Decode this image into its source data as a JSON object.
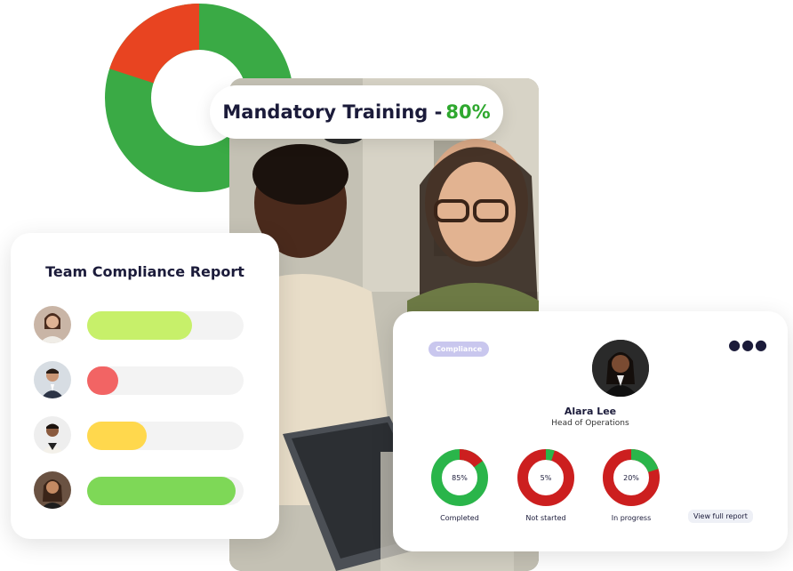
{
  "banner": {
    "label": "Mandatory Training -",
    "percent": "80%",
    "accent_color": "#2fa82f"
  },
  "big_donut": {
    "completed_fraction": 0.8,
    "remaining_fraction": 0.2,
    "colors": {
      "completed": "#3aaa45",
      "remaining": "#e84421"
    }
  },
  "team_report": {
    "title": "Team Compliance Report",
    "rows": [
      {
        "avatar": "avatar-woman-1",
        "progress": 0.67,
        "color": "#c7f06a"
      },
      {
        "avatar": "avatar-man-1",
        "progress": 0.2,
        "color": "#f26464"
      },
      {
        "avatar": "avatar-man-2",
        "progress": 0.38,
        "color": "#ffd84d"
      },
      {
        "avatar": "avatar-woman-2",
        "progress": 0.95,
        "color": "#7ed857"
      }
    ]
  },
  "profile_card": {
    "badge": "Compliance",
    "more_icon": "more-horizontal-icon",
    "name": "Alara Lee",
    "role": "Head of Operations",
    "stats": [
      {
        "percent": "85%",
        "value": 0.85,
        "label": "Completed"
      },
      {
        "percent": "5%",
        "value": 0.05,
        "label": "Not started"
      },
      {
        "percent": "20%",
        "value": 0.2,
        "label": "In progress"
      }
    ],
    "stat_colors": {
      "primary": "#2ab54a",
      "secondary": "#cc1f1f"
    },
    "view_report": "View  full report"
  }
}
